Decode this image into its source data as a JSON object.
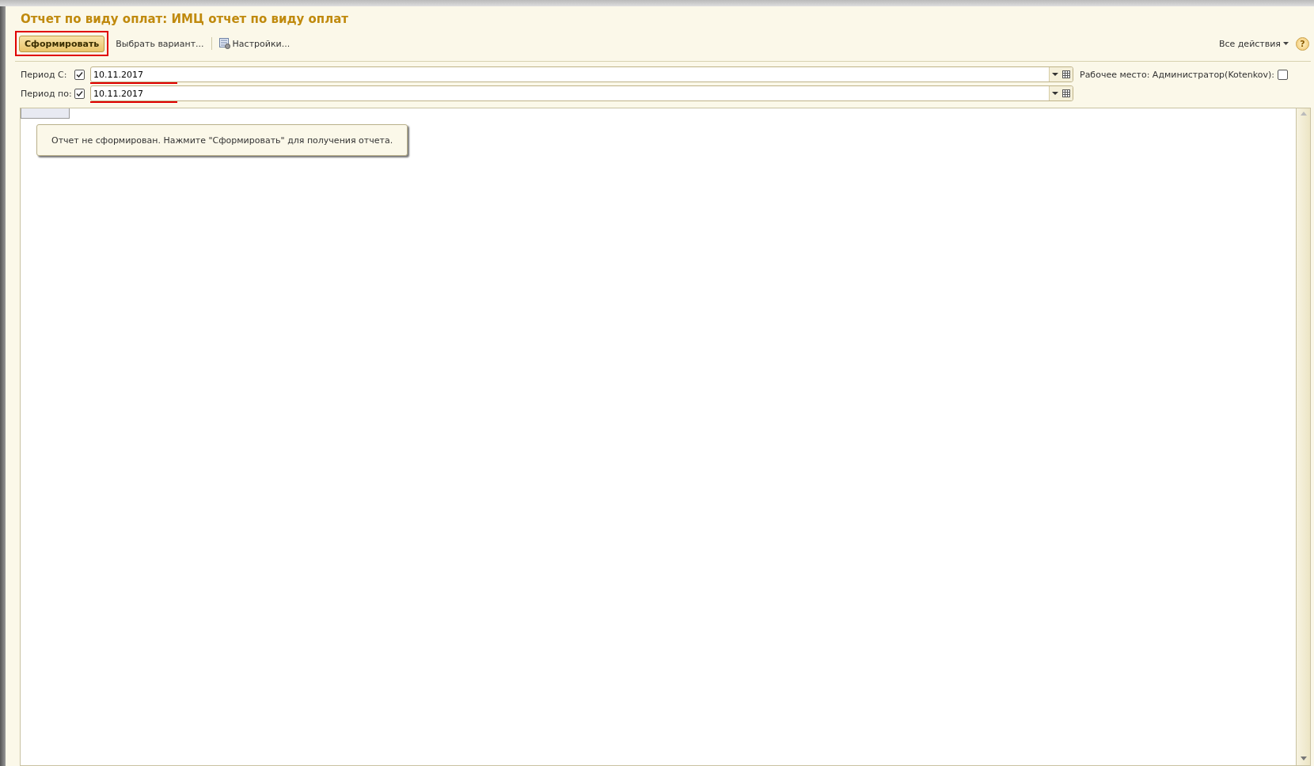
{
  "title": "Отчет по виду оплат: ИМЦ отчет по виду оплат",
  "toolbar": {
    "generate_button": "Сформировать",
    "highlighted": true,
    "variant_button": "Выбрать вариант...",
    "settings_button": "Настройки...",
    "all_actions": "Все действия",
    "help": "?"
  },
  "period_fields": [
    {
      "label": "Период С:",
      "checked": true,
      "value": "10.11.2017",
      "underlined": true
    },
    {
      "label": "Период по:",
      "checked": true,
      "value": "10.11.2017",
      "underlined": true
    }
  ],
  "workplace": {
    "label": "Рабочее место: Администратор(Kotenkov):",
    "checked": false
  },
  "report": {
    "message": "Отчет не сформирован. Нажмите \"Сформировать\" для получения отчета."
  }
}
